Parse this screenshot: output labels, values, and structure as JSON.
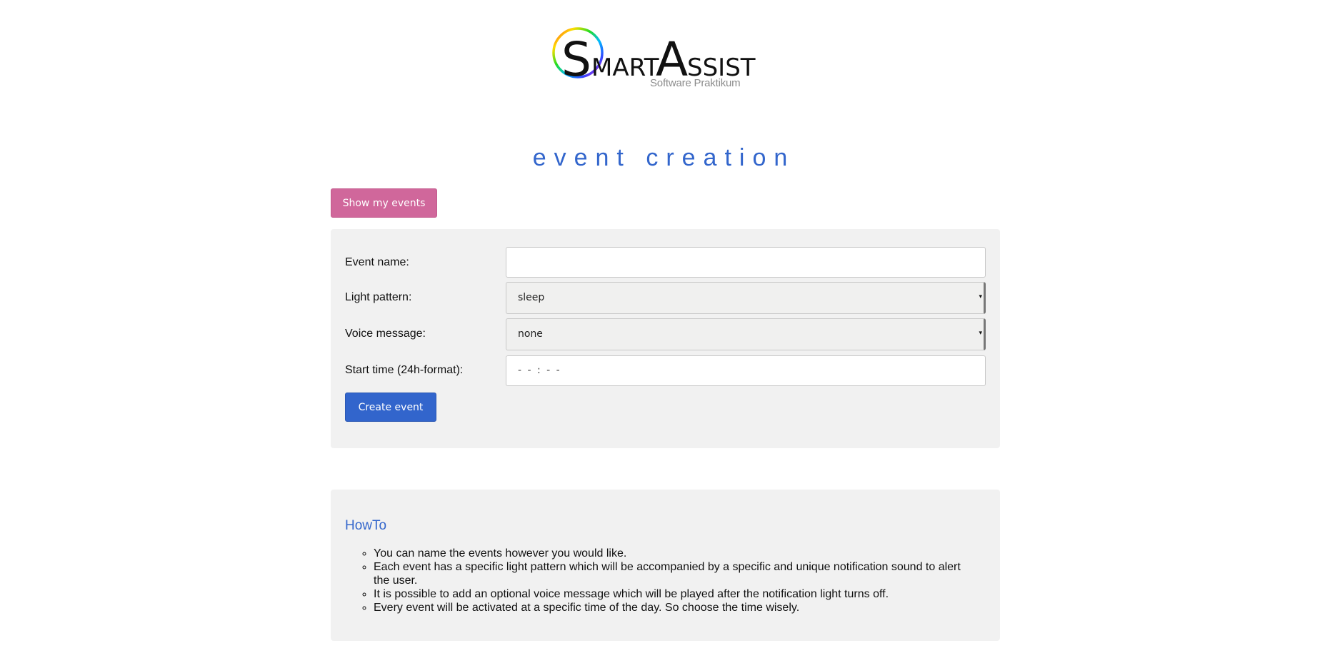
{
  "logo": {
    "name_first": "S",
    "name_rest_1": "MART",
    "name_second": "A",
    "name_rest_2": "SSIST",
    "subtitle": "Software Praktikum"
  },
  "page": {
    "title": "event creation"
  },
  "actions": {
    "show_events_label": "Show my events",
    "create_event_label": "Create event"
  },
  "form": {
    "event_name": {
      "label": "Event name:",
      "value": ""
    },
    "light_pattern": {
      "label": "Light pattern:",
      "selected": "sleep"
    },
    "voice_message": {
      "label": "Voice message:",
      "selected": "none"
    },
    "start_time": {
      "label": "Start time (24h-format):",
      "display": "- - : - -"
    }
  },
  "howto": {
    "title": "HowTo",
    "items": [
      "You can name the events however you would like.",
      "Each event has a specific light pattern which will be accompanied by a specific and unique notification sound to alert the user.",
      "It is possible to add an optional voice message which will be played after the notification light turns off.",
      "Every event will be activated at a specific time of the day. So choose the time wisely."
    ]
  },
  "colors": {
    "accent_blue": "#3366cc",
    "pink_button": "#d0679b",
    "panel_bg": "#f1f1f1"
  }
}
